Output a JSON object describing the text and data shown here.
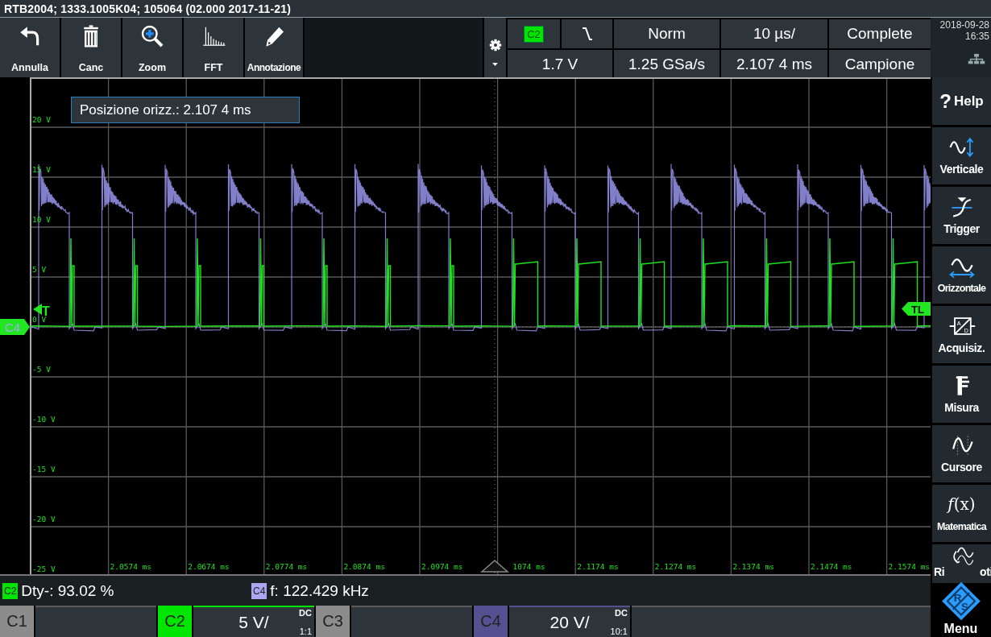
{
  "title_bar": {
    "title": "RTB2004; 1333.1005K04; 105064 (02.000 2017-11-21)"
  },
  "toolbar": [
    {
      "kind": "undo",
      "label": "Annulla"
    },
    {
      "kind": "delete",
      "label": "Canc"
    },
    {
      "kind": "zoom",
      "label": "Zoom"
    },
    {
      "kind": "fft",
      "label": "FFT"
    },
    {
      "kind": "annotate",
      "label": "Annotazione"
    }
  ],
  "status": {
    "trigger_source": "C2",
    "trigger_level": "1.7 V",
    "trigger_mode": "Norm",
    "sample_rate": "1.25 GSa/s",
    "time_scale": "10 µs/",
    "horizontal_position": "2.107 4 ms",
    "acquisition_state": "Complete",
    "acquisition_mode": "Campione"
  },
  "clock": {
    "date": "2018-09-28",
    "time": "16:35"
  },
  "plot": {
    "position_popup": "Posizione orizz.: 2.107 4 ms",
    "y_labels": [
      "20 V",
      "15 V",
      "10 V",
      "5 V",
      "0 V",
      "-5 V",
      "-10 V",
      "-15 V",
      "-20 V",
      "-25 V"
    ],
    "x_labels": [
      "2.0574 ms",
      "2.0674 ms",
      "2.0774 ms",
      "2.0874 ms",
      "2.0974 ms",
      "1074 ms",
      "2.1174 ms",
      "2.1274 ms",
      "2.1374 ms",
      "2.1474 ms",
      "2.1574 ms"
    ],
    "channel_marker": "C4",
    "trigger_marker": "T",
    "trigger_level_marker": "TL"
  },
  "measurements": [
    {
      "channel": "C2",
      "color": "#00e600",
      "text": "Dty-: 93.02 %"
    },
    {
      "channel": "C4",
      "color": "#a9a7f2",
      "text": "f: 122.429 kHz"
    }
  ],
  "channels": [
    {
      "name": "C1",
      "on": false
    },
    {
      "name": "C2",
      "on": true,
      "color": "#00e600",
      "scale": "5 V/",
      "coupling": "DC",
      "probe": "1:1"
    },
    {
      "name": "C3",
      "on": false
    },
    {
      "name": "C4",
      "on": true,
      "color": "#55508f",
      "scale": "20 V/",
      "coupling": "DC",
      "probe": "10:1"
    }
  ],
  "sidebar": [
    {
      "kind": "help",
      "glyph": "?",
      "label": "Help"
    },
    {
      "kind": "vertical",
      "label": "Verticale"
    },
    {
      "kind": "trigger",
      "label": "Trigger"
    },
    {
      "kind": "horizontal",
      "label": "Orizzontale"
    },
    {
      "kind": "acquire",
      "icon_letters": [
        "A",
        "D"
      ],
      "label": "Acquisiz."
    },
    {
      "kind": "measure",
      "label": "Misura"
    },
    {
      "kind": "cursor",
      "label": "Cursore"
    },
    {
      "kind": "math",
      "glyph": "f(x)",
      "label": "Matematica"
    },
    {
      "kind": "reference",
      "label": "Ri",
      "label_tail": "oti"
    }
  ],
  "menu": {
    "label": "Menu",
    "logo_top": "R",
    "logo_bottom": "S"
  }
}
